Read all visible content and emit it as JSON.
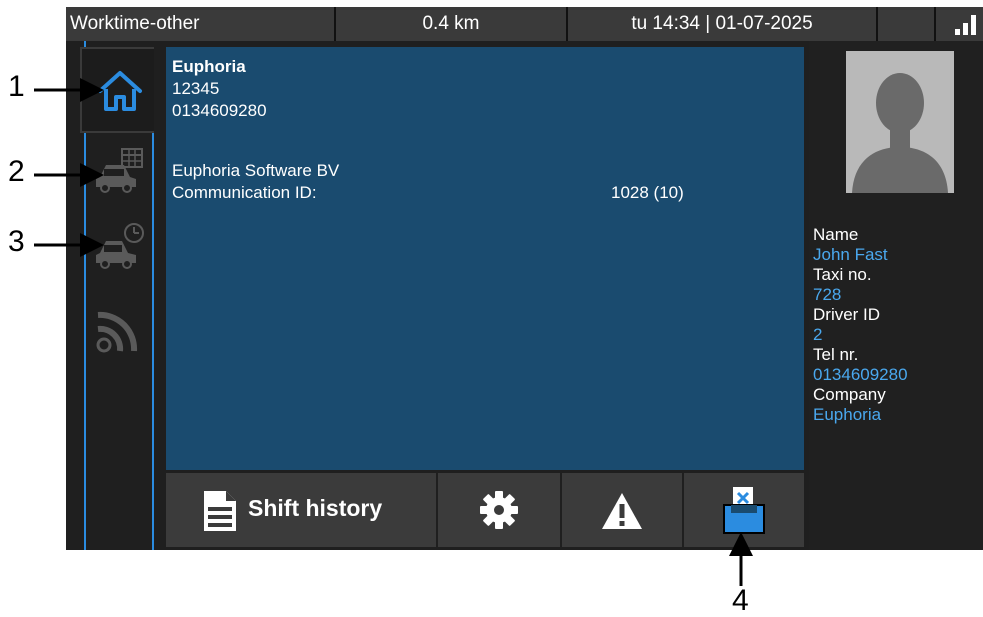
{
  "status_bar": {
    "title": "Worktime-other",
    "distance": "0.4 km",
    "datetime": "tu 14:34 | 01-07-2025"
  },
  "sidebar": {
    "items": [
      {
        "name": "home",
        "icon": "home-icon"
      },
      {
        "name": "car-schedule",
        "icon": "car-calendar-icon"
      },
      {
        "name": "car-clock",
        "icon": "car-clock-icon"
      },
      {
        "name": "signal",
        "icon": "rss-icon"
      }
    ]
  },
  "main": {
    "company_name": "Euphoria",
    "number": "12345",
    "phone": "0134609280",
    "company_full": "Euphoria Software BV",
    "communication_label": "Communication ID:",
    "communication_value": "1028 (10)"
  },
  "toolbar": {
    "shift_history_label": "Shift history"
  },
  "driver": {
    "name_label": "Name",
    "name_value": "John Fast",
    "taxi_label": "Taxi no.",
    "taxi_value": "728",
    "driver_id_label": "Driver ID",
    "driver_id_value": "2",
    "tel_label": "Tel nr.",
    "tel_value": "0134609280",
    "company_label": "Company",
    "company_value": "Euphoria"
  },
  "annotations": [
    "1",
    "2",
    "3",
    "4"
  ],
  "colors": {
    "accent": "#2b8ce0",
    "main_panel": "#1a4b6f",
    "value_text": "#4aa8ee"
  }
}
